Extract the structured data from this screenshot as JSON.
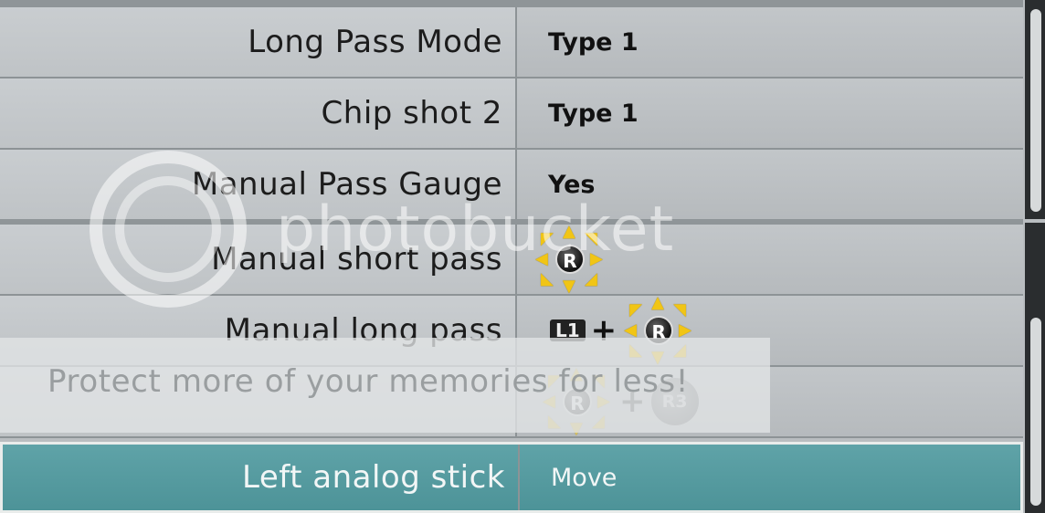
{
  "rows": [
    {
      "label": "Long Pass Mode",
      "value": "Type 1"
    },
    {
      "label": "Chip shot 2",
      "value": "Type 1"
    },
    {
      "label": "Manual Pass Gauge",
      "value": "Yes"
    },
    {
      "label": "Manual short pass",
      "value": ""
    },
    {
      "label": "Manual long pass",
      "value": ""
    },
    {
      "label": "",
      "value": ""
    },
    {
      "label": "Left analog stick",
      "value": "Move"
    }
  ],
  "icons": {
    "right_stick_letter": "R",
    "l1_label": "L1",
    "r3_label": "R3",
    "plus": "+"
  },
  "watermark": {
    "brand": "photobucket",
    "banner": "Protect more of your memories for less!"
  },
  "colors": {
    "highlight": "#4d9398",
    "cell": "#bfc3c6",
    "arrow": "#f1c515"
  }
}
